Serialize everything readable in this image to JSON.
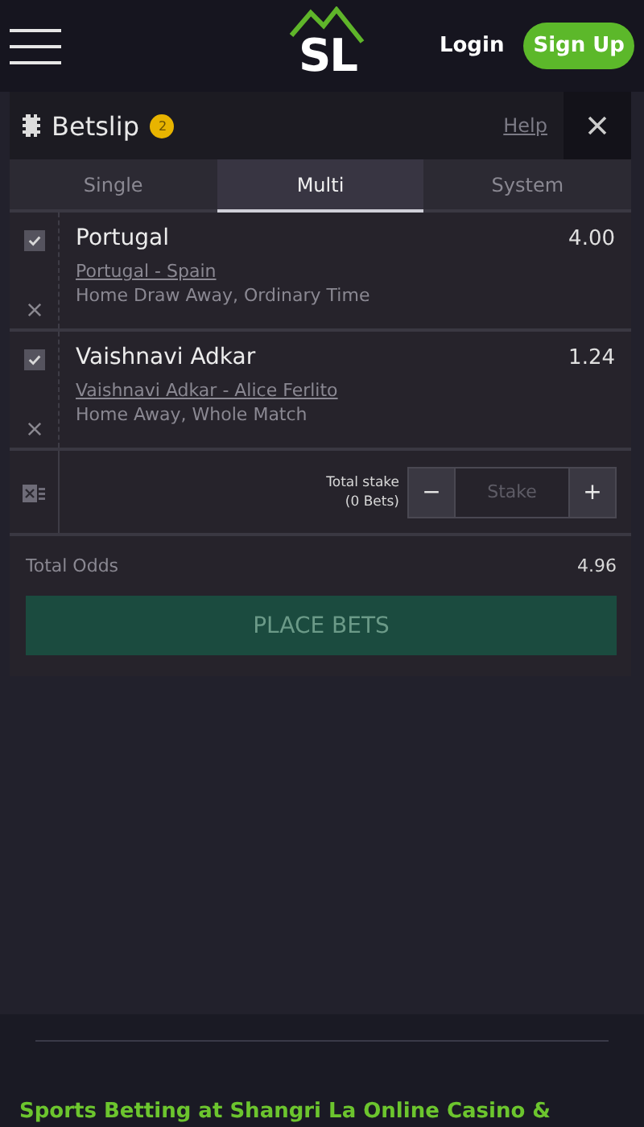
{
  "header": {
    "logo": "SL",
    "login": "Login",
    "signup": "Sign Up"
  },
  "betslip": {
    "title": "Betslip",
    "count": "2",
    "help": "Help",
    "tabs": [
      {
        "label": "Single",
        "selected": false
      },
      {
        "label": "Multi",
        "selected": true
      },
      {
        "label": "System",
        "selected": false
      }
    ],
    "selections": [
      {
        "name": "Portugal",
        "odds": "4.00",
        "event": "Portugal - Spain",
        "market": "Home Draw Away, Ordinary Time",
        "checked": true
      },
      {
        "name": "Vaishnavi Adkar",
        "odds": "1.24",
        "event": "Vaishnavi Adkar - Alice Ferlito",
        "market": "Home Away, Whole Match",
        "checked": true
      }
    ],
    "stake": {
      "label": "Total stake",
      "bets": "(0 Bets)",
      "minus": "−",
      "placeholder": "Stake",
      "plus": "+"
    },
    "total_odds_label": "Total Odds",
    "total_odds": "4.96",
    "place_bets": "PLACE BETS"
  },
  "footer": {
    "heading": "Sports Betting at Shangri La Online Casino &"
  }
}
